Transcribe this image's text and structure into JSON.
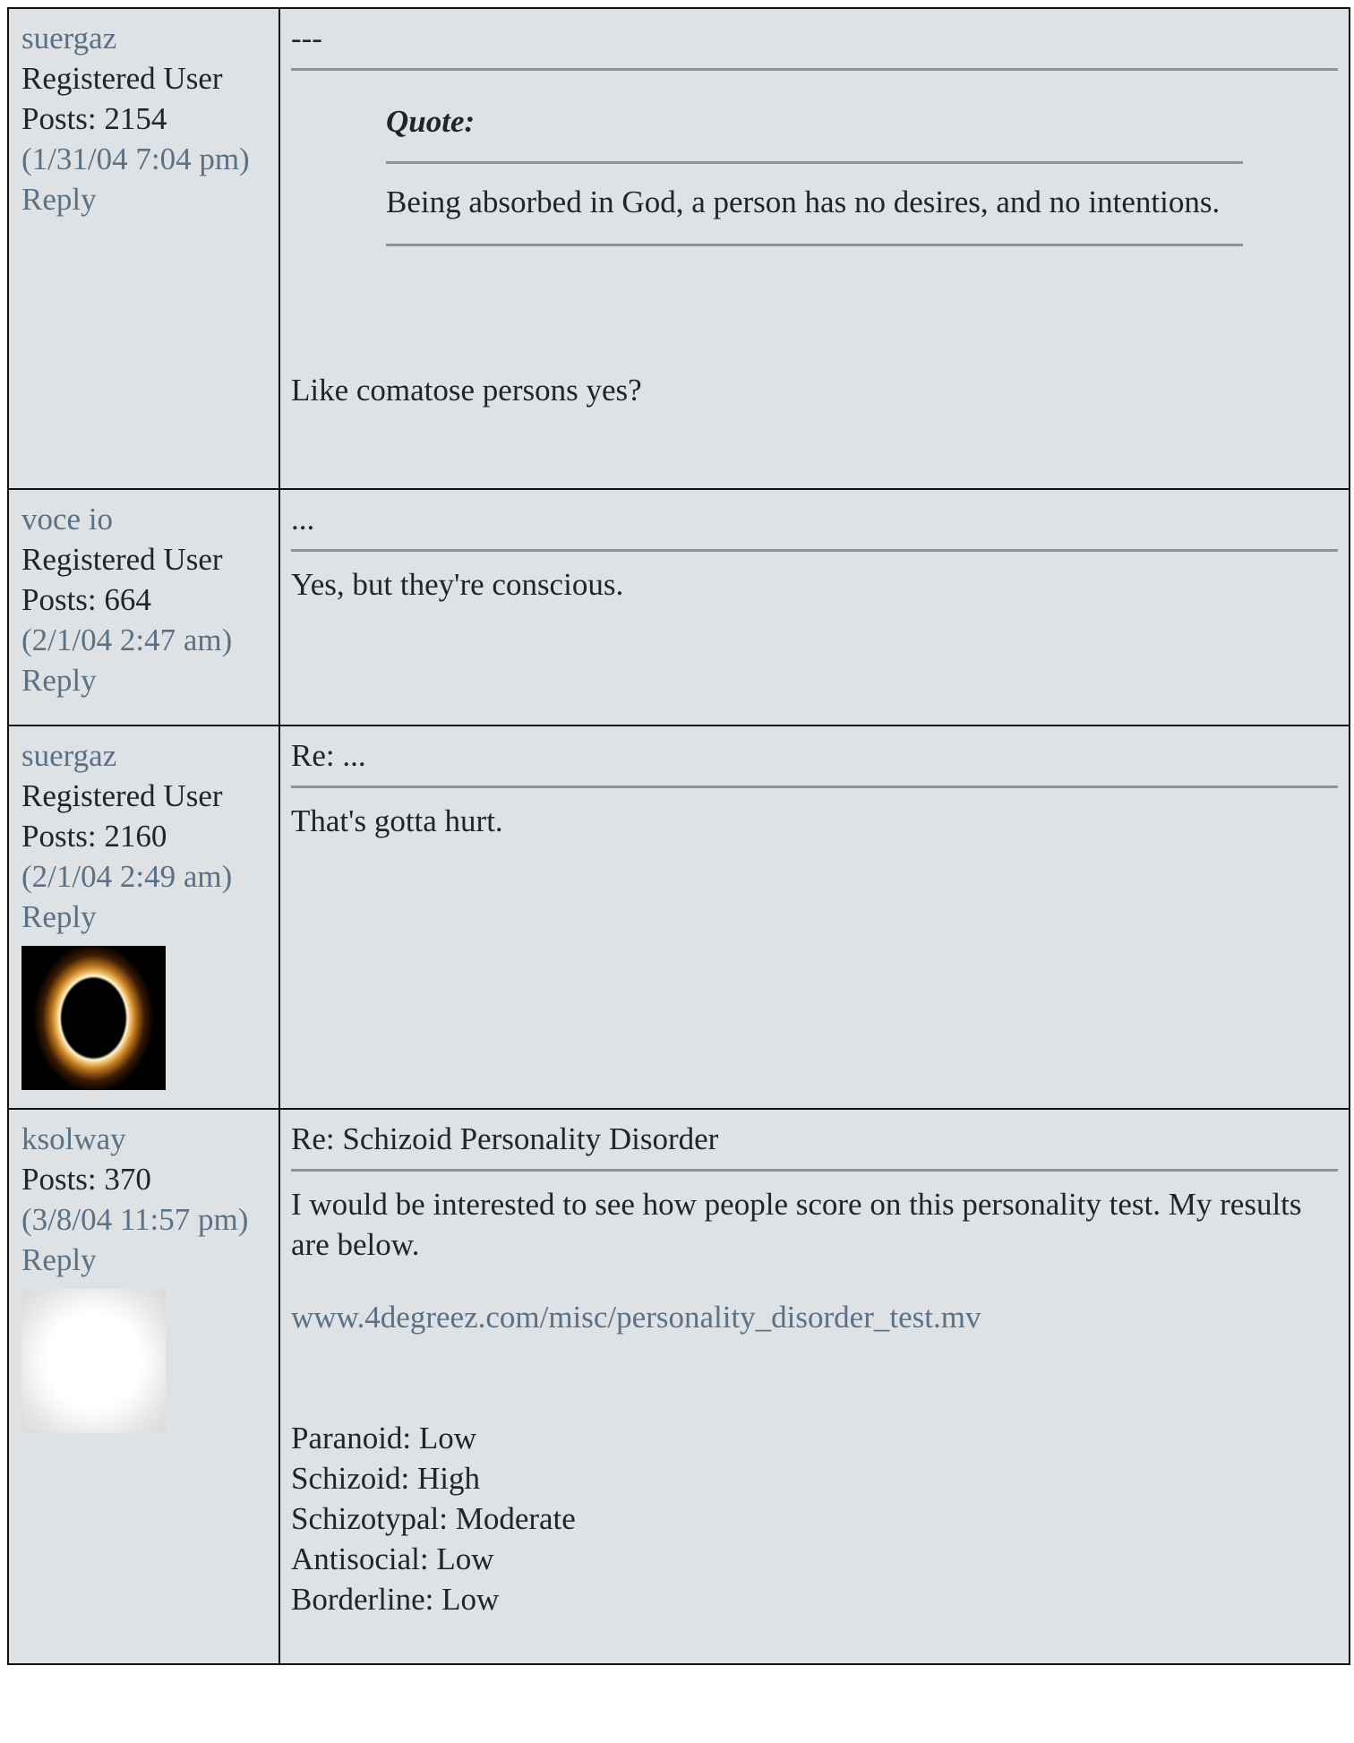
{
  "posts": [
    {
      "author": "suergaz",
      "role": "Registered User",
      "posts_count": "Posts: 2154",
      "timestamp": "(1/31/04 7:04 pm)",
      "reply_label": "Reply",
      "subject": "---",
      "quote": {
        "title": "Quote:",
        "text": "Being absorbed in God, a person has no desires, and no intentions."
      },
      "body": "Like comatose persons yes?"
    },
    {
      "author": "voce io",
      "role": "Registered User",
      "posts_count": "Posts: 664",
      "timestamp": "(2/1/04 2:47 am)",
      "reply_label": "Reply",
      "subject": "...",
      "body": "Yes, but they're conscious."
    },
    {
      "author": "suergaz",
      "role": "Registered User",
      "posts_count": "Posts: 2160",
      "timestamp": "(2/1/04 2:49 am)",
      "reply_label": "Reply",
      "subject": "Re: ...",
      "body": "That's gotta hurt.",
      "avatar": "eclipse-avatar"
    },
    {
      "author": "ksolway",
      "posts_count": "Posts: 370",
      "timestamp": "(3/8/04 11:57 pm)",
      "reply_label": "Reply",
      "subject": "Re: Schizoid Personality Disorder",
      "body_intro": "I would be interested to see how people score on this personality test. My results are below.",
      "link": "www.4degreez.com/misc/personality_disorder_test.mv",
      "results": [
        "Paranoid: Low",
        "Schizoid: High",
        "Schizotypal: Moderate",
        "Antisocial: Low",
        "Borderline: Low"
      ],
      "avatar": "glow-avatar"
    }
  ]
}
